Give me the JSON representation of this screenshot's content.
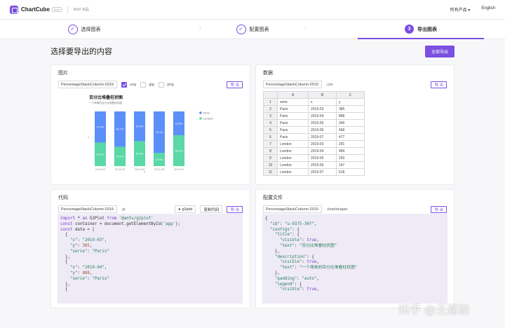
{
  "app": {
    "brand": "ChartCube",
    "beta": "beta",
    "demo_label": "AntV 出品",
    "nav_products": "所有产品 ▾",
    "nav_lang": "English"
  },
  "steps": [
    {
      "label": "选择图表"
    },
    {
      "label": "配置图表"
    },
    {
      "number": "3",
      "label": "导出图表"
    }
  ],
  "page": {
    "title": "选择要导出的内容",
    "export_all": "全部导出"
  },
  "image_panel": {
    "title": "图片",
    "filename": "PercentageStackColumn-2019",
    "export": "导 出",
    "formats": [
      {
        "label": ".svg",
        "checked": true
      },
      {
        "label": ".jpg",
        "checked": false
      },
      {
        "label": ".png",
        "checked": false
      }
    ],
    "chart_title": "百分比堆叠柱状图",
    "chart_subtitle": "一个简单的百分比堆叠柱状图"
  },
  "chart_data": {
    "type": "bar",
    "title": "百分比堆叠柱状图",
    "subtitle": "一个简单的百分比堆叠柱状图",
    "xlabel": "x",
    "ylabel": "y",
    "categories": [
      "2019-03",
      "2019-04",
      "2019-05",
      "2019-06",
      "2019-07"
    ],
    "series": [
      {
        "name": "Paris",
        "values": [
          385,
          888,
          349,
          468,
          477
        ],
        "color": "#5B8FF9"
      },
      {
        "name": "London",
        "values": [
          291,
          484,
          293,
          147,
          618
        ],
        "color": "#5AD8A6"
      }
    ],
    "labels_top": [
      "57.0%",
      "64.7%",
      "54.4%",
      "76.1%",
      "43.6%"
    ],
    "labels_bottom": [
      "43.0%",
      "35.3%",
      "45.6%",
      "23.9%",
      "56.4%"
    ],
    "legend_position": "right",
    "ylim": [
      0,
      1
    ]
  },
  "data_panel": {
    "title": "数据",
    "filename": "PercentageStackColumn-2019",
    "ext": ".csv",
    "export": "导 出",
    "columns": [
      "",
      "A",
      "B",
      "C"
    ],
    "rows": [
      [
        "1",
        "serie",
        "x",
        "y"
      ],
      [
        "2",
        "Paris",
        "2019-03",
        "385"
      ],
      [
        "3",
        "Paris",
        "2019-04",
        "888"
      ],
      [
        "4",
        "Paris",
        "2019-05",
        "349"
      ],
      [
        "5",
        "Paris",
        "2019-06",
        "468"
      ],
      [
        "6",
        "Paris",
        "2019-07",
        "477"
      ],
      [
        "7",
        "London",
        "2019-03",
        "291"
      ],
      [
        "8",
        "London",
        "2019-04",
        "484"
      ],
      [
        "9",
        "London",
        "2019-05",
        "293"
      ],
      [
        "10",
        "London",
        "2019-06",
        "147"
      ],
      [
        "11",
        "London",
        "2019-07",
        "618"
      ]
    ]
  },
  "code_panel": {
    "title": "代码",
    "filename": "PercentageStackColumn-2019",
    "ext": ".js",
    "g2plot_btn": "g2plot",
    "copy_btn": "复制代码",
    "export": "导 出",
    "lines": [
      "import * as G2Plot from '@antv/g2plot'",
      "const container = document.getElementById('app');",
      "const data = [",
      "  {",
      "    \"x\": \"2019-03\",",
      "    \"y\": 385,",
      "    \"serie\": \"Paris\"",
      "  },",
      "  {",
      "    \"x\": \"2019-04\",",
      "    \"y\": 888,",
      "    \"serie\": \"Paris\"",
      "  },",
      "  {"
    ]
  },
  "config_panel": {
    "title": "配置文件",
    "filename": "PercentageStackColumn-2019",
    "ext": ".chartshaper",
    "export": "导 出",
    "lines": [
      "{",
      "  \"id\": \"u-9375-36f\",",
      "  \"configs\": {",
      "    \"title\": {",
      "      \"visible\": true,",
      "      \"text\": \"百分比堆叠柱状图\"",
      "    },",
      "    \"description\": {",
      "      \"visible\": true,",
      "      \"text\": \"一个简单的百分比堆叠柱状图\"",
      "    },",
      "    \"padding\": \"auto\",",
      "    \"legend\": {",
      "      \"visible\": true,"
    ]
  },
  "watermark": "知乎 @王嘉喆"
}
